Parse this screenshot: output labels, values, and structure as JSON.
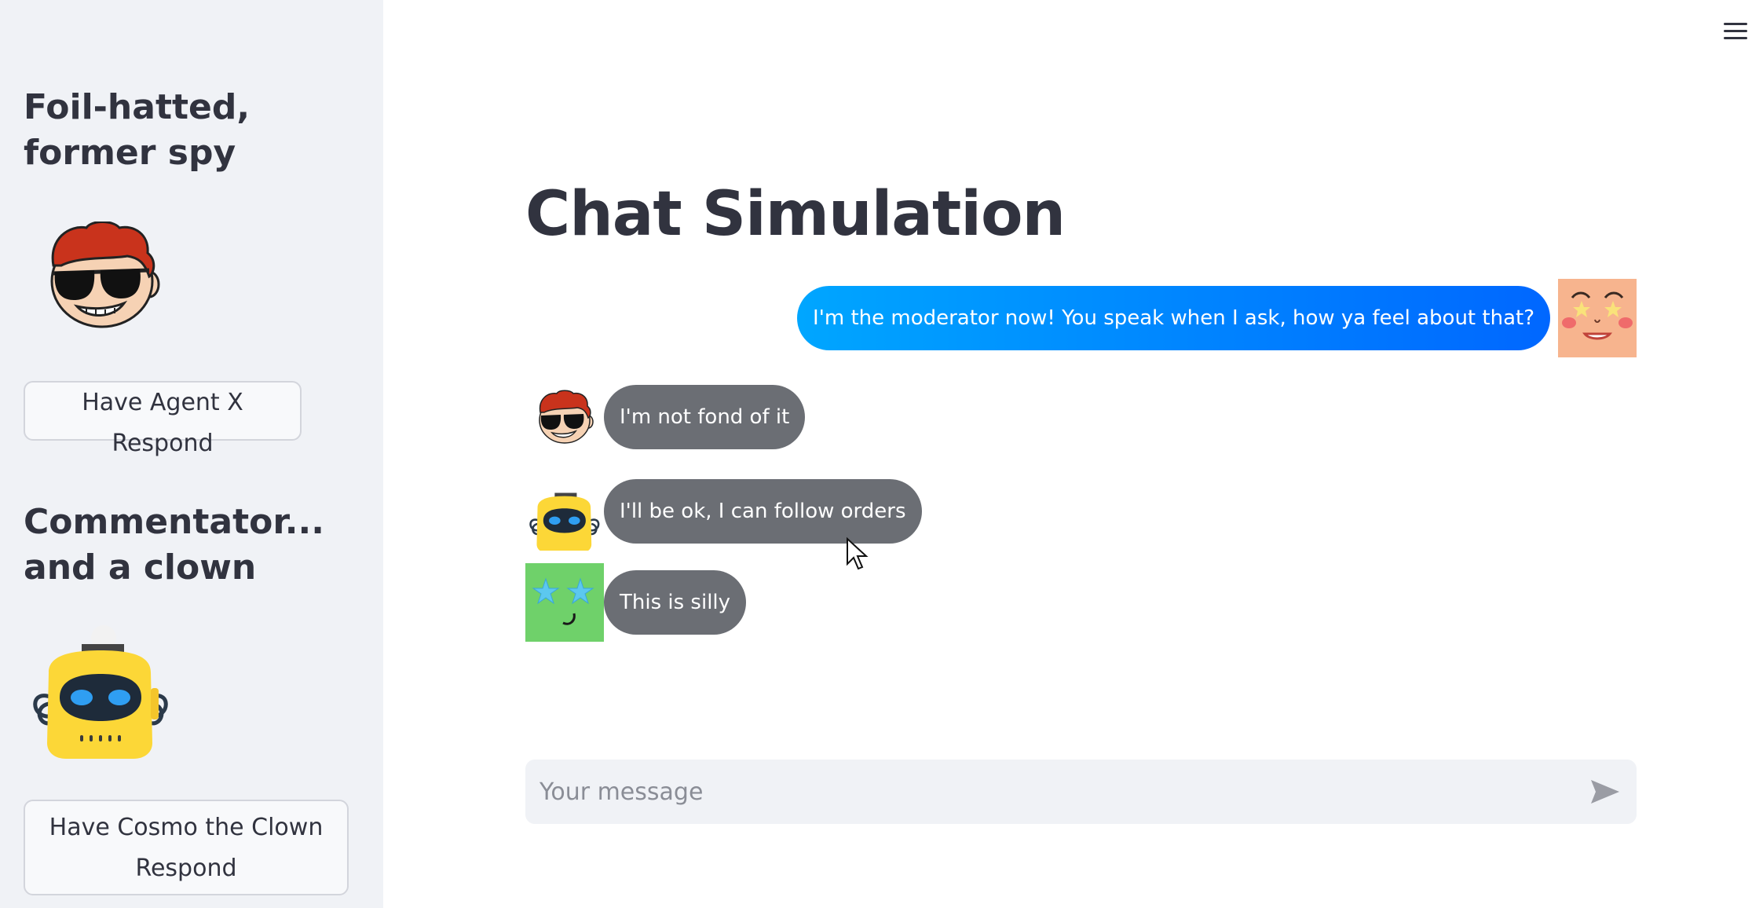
{
  "sidebar": {
    "agents": [
      {
        "name": "Foil-hatted, former spy",
        "button_label": "Have Agent X Respond",
        "avatar_icon": "spy-sunglasses-avatar-icon"
      },
      {
        "name": "Commentator... and a clown",
        "button_label": "Have Cosmo the Clown Respond",
        "avatar_icon": "yellow-robot-avatar-icon"
      }
    ]
  },
  "header": {
    "menu_icon": "hamburger-menu-icon"
  },
  "main": {
    "title": "Chat Simulation",
    "messages": [
      {
        "role": "user",
        "text": "I'm the moderator now! You speak when I ask, how ya feel about that?",
        "avatar_icon": "peach-star-eyes-avatar-icon"
      },
      {
        "role": "agent",
        "text": "I'm not fond of it",
        "avatar_icon": "spy-sunglasses-avatar-icon"
      },
      {
        "role": "agent",
        "text": "I'll be ok, I can follow orders",
        "avatar_icon": "yellow-robot-avatar-icon"
      },
      {
        "role": "agent",
        "text": "This is silly",
        "avatar_icon": "green-star-eyes-avatar-icon"
      }
    ],
    "input": {
      "placeholder": "Your message",
      "value": "",
      "send_icon": "send-arrow-icon"
    }
  },
  "colors": {
    "sidebar_bg": "#f0f2f6",
    "user_bubble_start": "#00a6ff",
    "user_bubble_end": "#0067ff",
    "agent_bubble": "#6b6e74",
    "text": "#31333f"
  }
}
